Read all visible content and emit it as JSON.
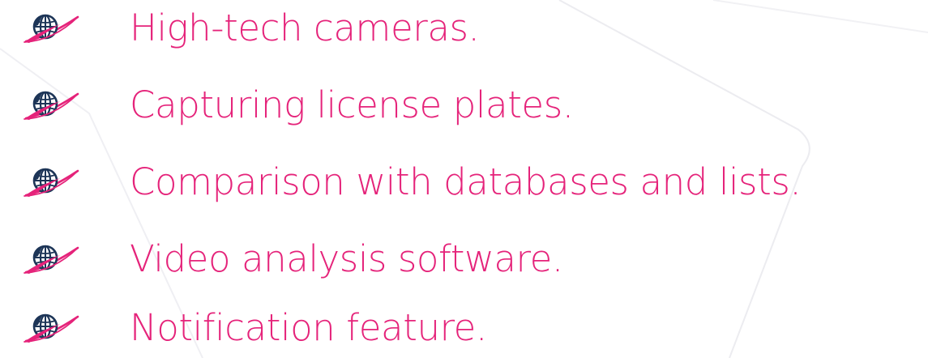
{
  "colors": {
    "text": "#e5237a",
    "icon_globe": "#1d3557",
    "icon_swoosh": "#e5237a",
    "background_lines": "#e9e9ee"
  },
  "features": [
    {
      "icon": "globe-swoosh-icon",
      "text": "High-tech cameras."
    },
    {
      "icon": "globe-swoosh-icon",
      "text": "Capturing license plates."
    },
    {
      "icon": "globe-swoosh-icon",
      "text": "Comparison with databases and lists."
    },
    {
      "icon": "globe-swoosh-icon",
      "text": "Video analysis software."
    },
    {
      "icon": "globe-swoosh-icon",
      "text": "Notification feature."
    }
  ]
}
